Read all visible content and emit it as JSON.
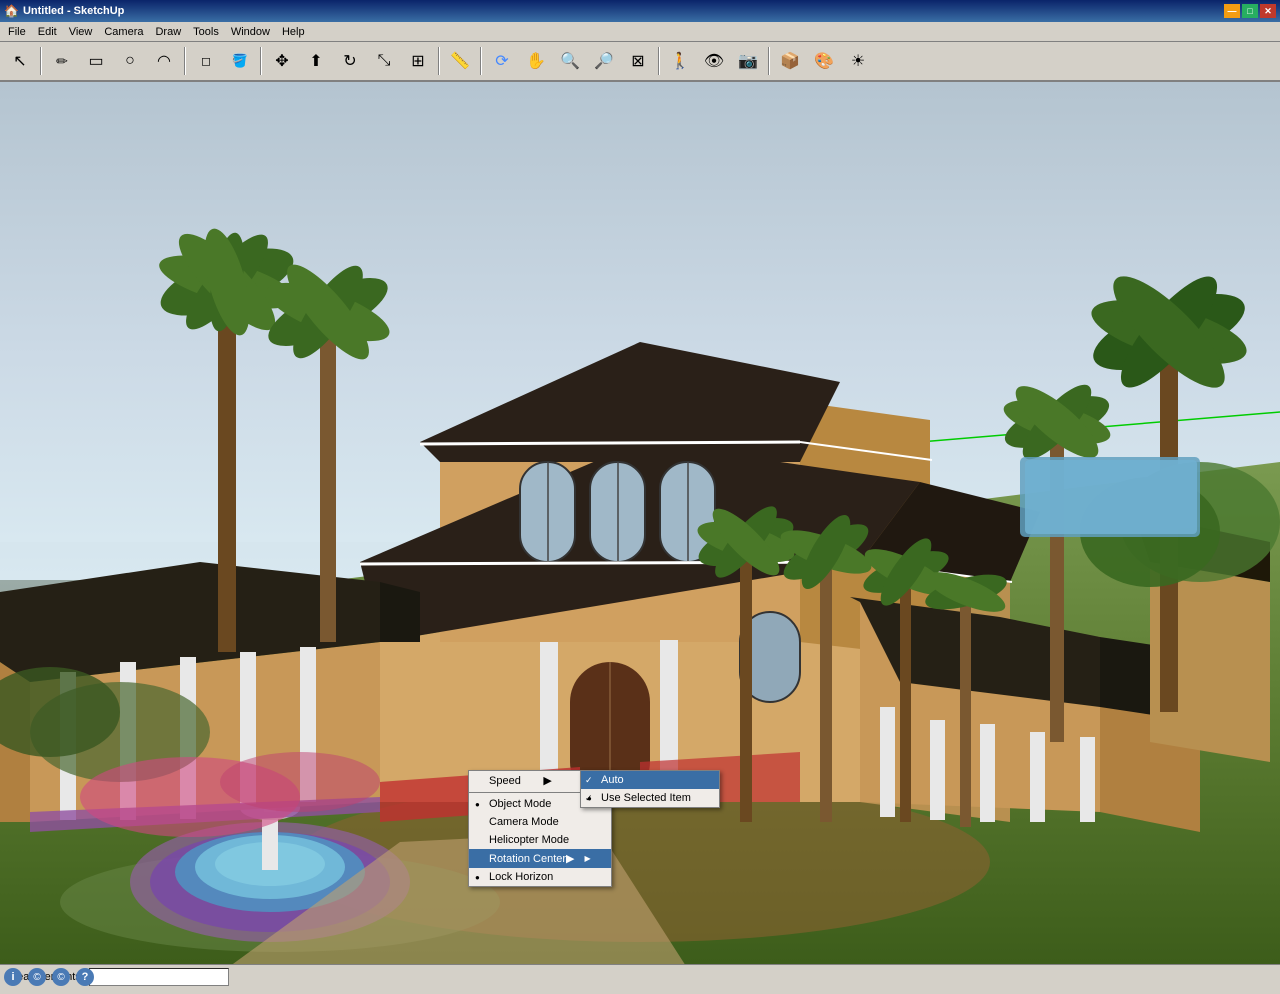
{
  "app": {
    "title": "Untitled - SketchUp",
    "icon": "🏠"
  },
  "titlebar": {
    "title": "Untitled - SketchUp",
    "min_btn": "—",
    "max_btn": "□",
    "close_btn": "✕"
  },
  "menubar": {
    "items": [
      {
        "label": "File",
        "id": "file"
      },
      {
        "label": "Edit",
        "id": "edit"
      },
      {
        "label": "View",
        "id": "view"
      },
      {
        "label": "Camera",
        "id": "camera"
      },
      {
        "label": "Draw",
        "id": "draw"
      },
      {
        "label": "Tools",
        "id": "tools"
      },
      {
        "label": "Window",
        "id": "window"
      },
      {
        "label": "Help",
        "id": "help"
      }
    ]
  },
  "toolbar": {
    "tools": [
      {
        "name": "select",
        "icon": "↖",
        "label": "Select"
      },
      {
        "name": "pencil",
        "icon": "✏",
        "label": "Pencil"
      },
      {
        "name": "rectangle",
        "icon": "▭",
        "label": "Rectangle"
      },
      {
        "name": "circle",
        "icon": "○",
        "label": "Circle"
      },
      {
        "name": "arc",
        "icon": "◠",
        "label": "Arc"
      },
      {
        "name": "erase",
        "icon": "◻",
        "label": "Erase"
      },
      {
        "name": "paint",
        "icon": "🎨",
        "label": "Paint Bucket"
      },
      {
        "name": "pushpull",
        "icon": "⬆",
        "label": "Push/Pull"
      },
      {
        "name": "move",
        "icon": "✥",
        "label": "Move"
      },
      {
        "name": "rotate",
        "icon": "↻",
        "label": "Rotate"
      },
      {
        "name": "scale",
        "icon": "⤡",
        "label": "Scale"
      },
      {
        "name": "offset",
        "icon": "⊞",
        "label": "Offset"
      },
      {
        "name": "tape",
        "icon": "📏",
        "label": "Tape Measure"
      },
      {
        "name": "orbit",
        "icon": "⟳",
        "label": "Orbit"
      },
      {
        "name": "pan",
        "icon": "✋",
        "label": "Pan"
      },
      {
        "name": "zoom",
        "icon": "🔍",
        "label": "Zoom"
      },
      {
        "name": "zoomext",
        "icon": "⊠",
        "label": "Zoom Extents"
      },
      {
        "name": "walk",
        "icon": "🚶",
        "label": "Walk"
      },
      {
        "name": "lookaround",
        "icon": "👁",
        "label": "Look Around"
      },
      {
        "name": "position",
        "icon": "📌",
        "label": "Position Camera"
      },
      {
        "name": "component",
        "icon": "📦",
        "label": "Components"
      },
      {
        "name": "materials",
        "icon": "🎭",
        "label": "Materials"
      },
      {
        "name": "shadows",
        "icon": "☀",
        "label": "Shadows"
      }
    ]
  },
  "context_menu": {
    "items": [
      {
        "id": "speed",
        "label": "Speed",
        "has_submenu": true,
        "checked": false
      },
      {
        "id": "separator1",
        "type": "sep"
      },
      {
        "id": "object_mode",
        "label": "Object Mode",
        "checked": true
      },
      {
        "id": "camera_mode",
        "label": "Camera Mode",
        "checked": false
      },
      {
        "id": "helicopter_mode",
        "label": "Helicopter Mode",
        "checked": false
      },
      {
        "id": "rotation_center",
        "label": "Rotation Center",
        "has_submenu": true,
        "checked": false,
        "active": true
      },
      {
        "id": "lock_horizon",
        "label": "Lock Horizon",
        "checked": true
      }
    ],
    "submenu_rotation": {
      "items": [
        {
          "id": "auto",
          "label": "Auto",
          "checked": true,
          "active": true
        },
        {
          "id": "use_selected",
          "label": "Use Selected Item",
          "checked": true
        }
      ]
    }
  },
  "statusbar": {
    "measurements_label": "Measurements",
    "measurements_value": ""
  },
  "bottom_icons": [
    {
      "name": "info-icon",
      "symbol": "ℹ",
      "color": "#4a7ab5",
      "label": "Info"
    },
    {
      "name": "creative-commons-icon",
      "symbol": "©",
      "color": "#4a7ab5",
      "label": "Creative Commons"
    },
    {
      "name": "attribution-icon",
      "symbol": "©",
      "color": "#4a7ab5",
      "label": "Attribution"
    },
    {
      "name": "help-icon",
      "symbol": "?",
      "color": "#4a7ab5",
      "label": "Help"
    }
  ]
}
